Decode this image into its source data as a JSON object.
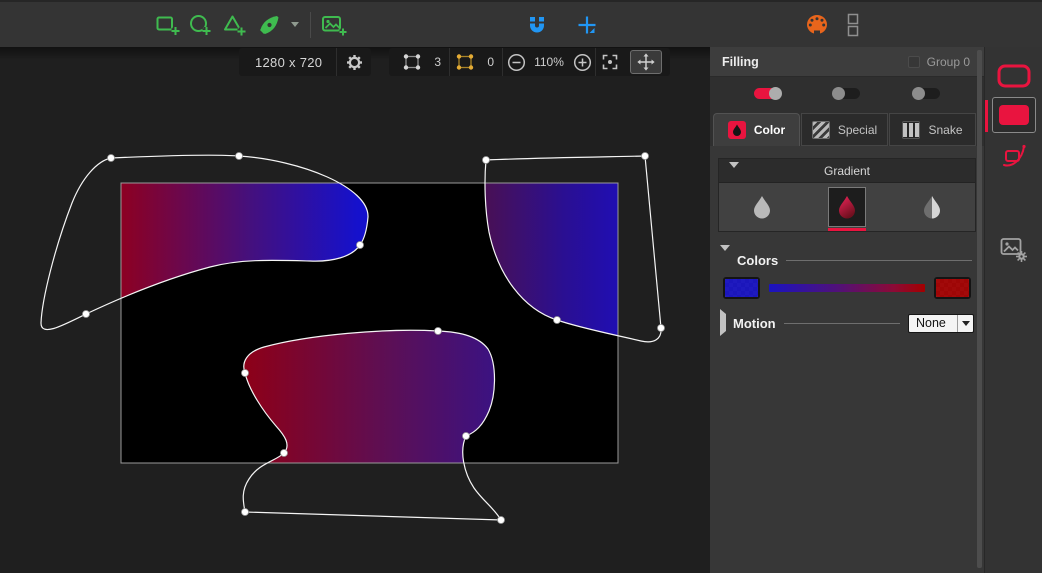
{
  "topbar": {
    "tool_icons": [
      "draw-rectangle-add",
      "draw-ellipse-add",
      "draw-polygon-add",
      "pen-bezier",
      "pen-dropdown",
      "image-add",
      "snap-magnet",
      "position-crosshair",
      "palette",
      "panel-layout"
    ]
  },
  "canvas": {
    "size_label": "1280 x 720",
    "path_nodes_count": "3",
    "selected_nodes_count": "0",
    "zoom_level": "110%"
  },
  "panel": {
    "title": "Filling",
    "group_label": "Group 0",
    "toggles": [
      {
        "state": "on"
      },
      {
        "state": "off"
      },
      {
        "state": "off"
      }
    ],
    "tabs": [
      {
        "label": "Color",
        "active": true
      },
      {
        "label": "Special",
        "active": false
      },
      {
        "label": "Snake",
        "active": false
      }
    ],
    "gradient_section": {
      "title": "Gradient",
      "options": [
        "solid-droplet",
        "gradient-droplet",
        "pattern-droplet"
      ],
      "selected": "gradient-droplet"
    },
    "colors_section": {
      "title": "Colors",
      "start_color": "#1a13c0",
      "end_color": "#a40000"
    },
    "motion_section": {
      "title": "Motion",
      "selected": "None"
    }
  },
  "right_toolbar": {
    "icons": [
      "stroke-rectangle",
      "fill-rectangle",
      "stroke-style",
      "image-settings"
    ],
    "selected": "fill-rectangle"
  },
  "colors": {
    "accent_red": "#e9143f",
    "tool_green": "#3fbb4f",
    "tool_blue": "#2196f3",
    "palette_orange": "#e8651c",
    "canvas_background": "#000000",
    "shape_gradient_red": "#8d0022",
    "shape_gradient_blue": "#1511cc"
  }
}
